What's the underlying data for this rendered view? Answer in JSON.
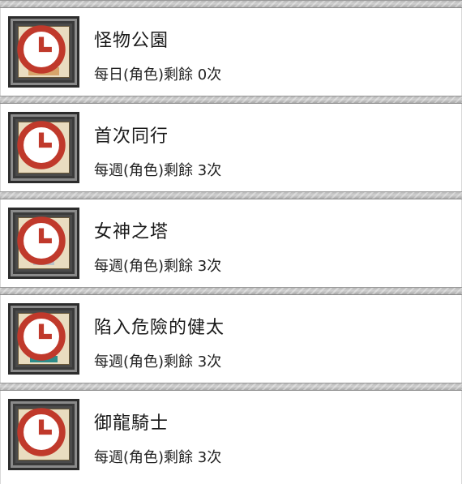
{
  "rows": [
    {
      "title": "怪物公園",
      "remaining": "每日(角色)剩餘 0次",
      "icon": "monster-park-icon"
    },
    {
      "title": "首次同行",
      "remaining": "每週(角色)剩餘 3次",
      "icon": "first-companion-icon"
    },
    {
      "title": "女神之塔",
      "remaining": "每週(角色)剩餘 3次",
      "icon": "goddess-tower-icon"
    },
    {
      "title": "陷入危險的健太",
      "remaining": "每週(角色)剩餘 3次",
      "icon": "kenta-in-danger-icon"
    },
    {
      "title": "御龍騎士",
      "remaining": "每週(角色)剩餘 3次",
      "icon": "dragon-rider-icon"
    }
  ],
  "colors": {
    "divider": "#b8b8b8",
    "frame": "#2c2c2c",
    "clock": "#c0392b"
  }
}
